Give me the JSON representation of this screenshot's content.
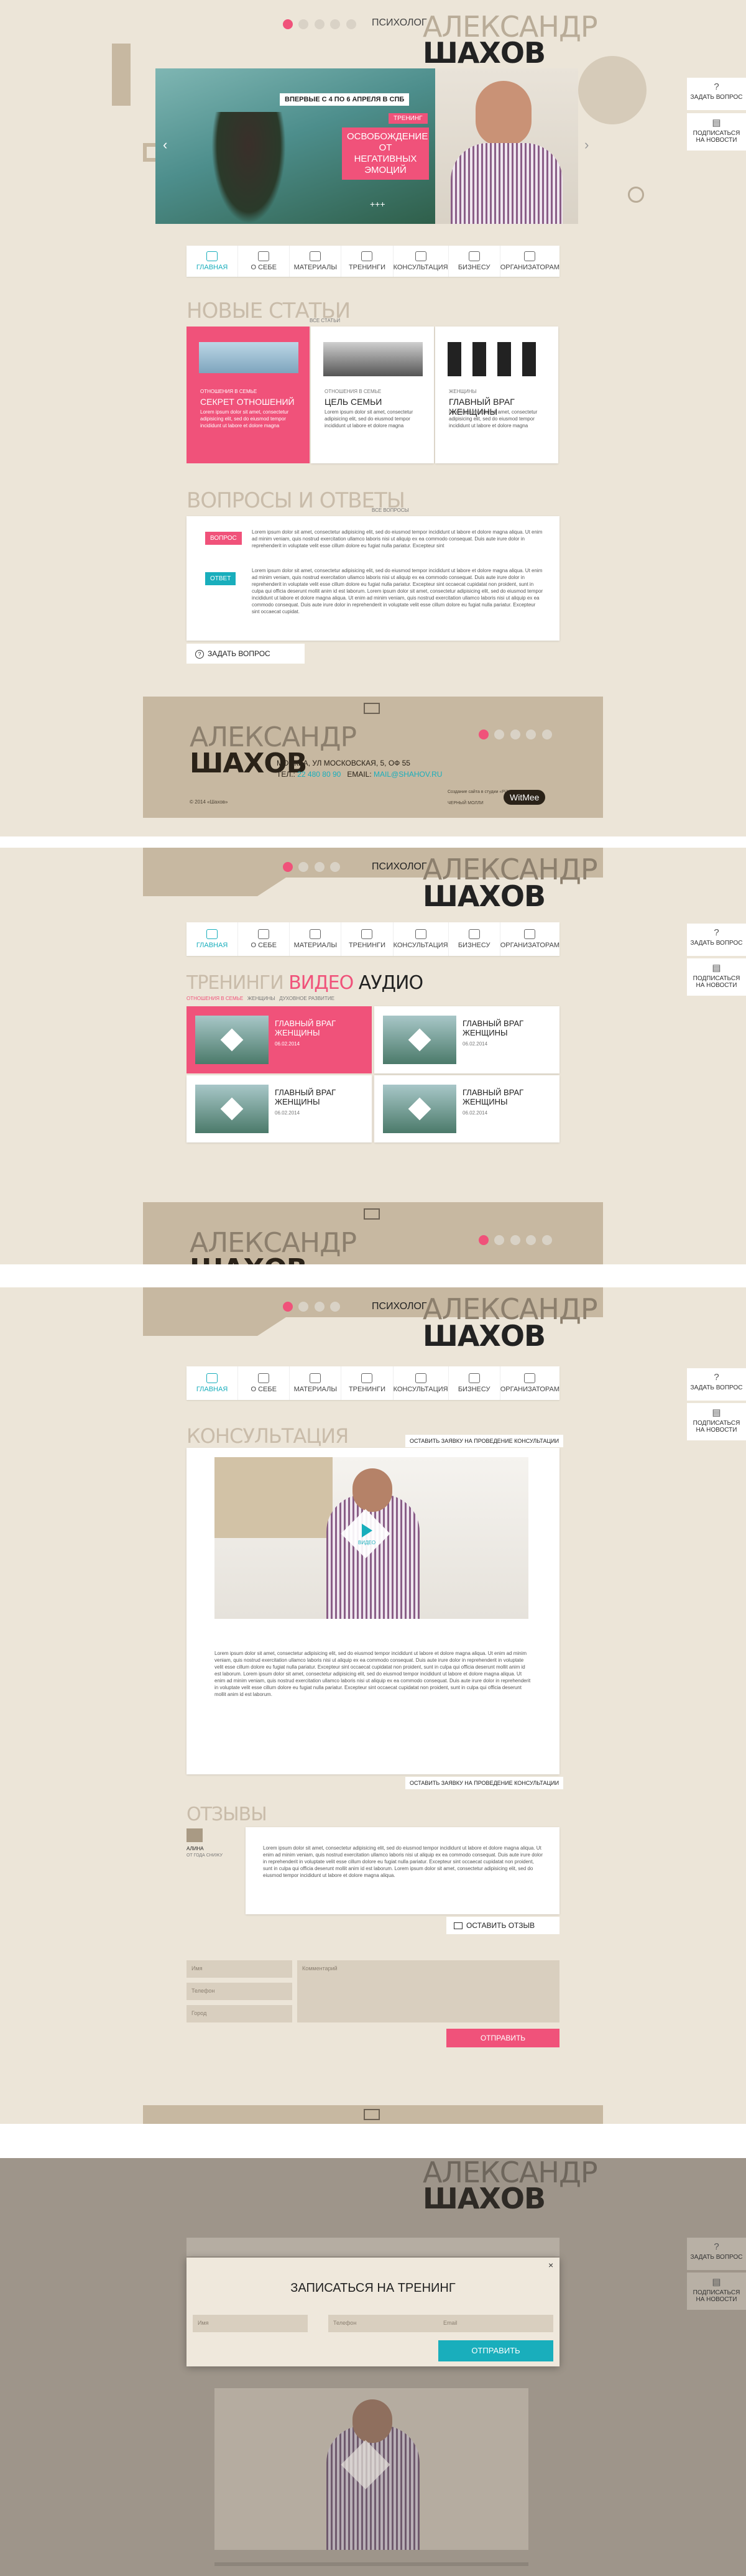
{
  "brand": {
    "first_name": "АЛЕКСАНДР",
    "last_name": "ШАХОВ",
    "role": "ПСИХОЛОГ"
  },
  "nav": [
    {
      "label": "ГЛАВНАЯ"
    },
    {
      "label": "О СЕБЕ"
    },
    {
      "label": "МАТЕРИАЛЫ"
    },
    {
      "label": "ТРЕНИНГИ"
    },
    {
      "label": "КОНСУЛЬТАЦИЯ"
    },
    {
      "label": "БИЗНЕСУ"
    },
    {
      "label": "ОРГАНИЗАТОРАМ"
    }
  ],
  "side": {
    "ask": "ЗАДАТЬ ВОПРОС",
    "subscribe": "ПОДПИСАТЬСЯ НА НОВОСТИ"
  },
  "hero": {
    "date_text": "ВПЕРВЫЕ С 4 ПО 6 АПРЕЛЯ В СПБ",
    "tag": "ТРЕНИНГ",
    "headline": "ОСВОБОЖДЕНИЕ ОТ НЕГАТИВНЫХ ЭМОЦИЙ",
    "more": "+++"
  },
  "articles": {
    "title": "НОВЫЕ СТАТЬИ",
    "all": "ВСЕ СТАТЬИ",
    "items": [
      {
        "category": "ОТНОШЕНИЯ В СЕМЬЕ",
        "title": "СЕКРЕТ ОТНОШЕНИЙ",
        "text": "Lorem ipsum dolor sit amet, consectetur adipisicing elit, sed do eiusmod tempor incididunt ut labore et dolore magna"
      },
      {
        "category": "ОТНОШЕНИЯ В СЕМЬЕ",
        "title": "ЦЕЛЬ СЕМЬИ",
        "text": "Lorem ipsum dolor sit amet, consectetur adipisicing elit, sed do eiusmod tempor incididunt ut labore et dolore magna"
      },
      {
        "category": "ЖЕНЩИНЫ",
        "title": "ГЛАВНЫЙ ВРАГ ЖЕНЩИНЫ",
        "text": "Lorem ipsum dolor sit amet, consectetur adipisicing elit, sed do eiusmod tempor incididunt ut labore et dolore magna"
      }
    ]
  },
  "qa": {
    "title": "ВОПРОСЫ И ОТВЕТЫ",
    "all": "ВСЕ ВОПРОСЫ",
    "q_label": "ВОПРОС",
    "a_label": "ОТВЕТ",
    "q_text": "Lorem ipsum dolor sit amet, consectetur adipisicing elit, sed do eiusmod tempor incididunt ut labore et dolore magna aliqua. Ut enim ad minim veniam, quis nostrud exercitation ullamco laboris nisi ut aliquip ex ea commodo consequat. Duis aute irure dolor in reprehenderit in voluptate velit esse cillum dolore eu fugiat nulla pariatur. Excepteur sint",
    "a_text": "Lorem ipsum dolor sit amet, consectetur adipisicing elit, sed do eiusmod tempor incididunt ut labore et dolore magna aliqua. Ut enim ad minim veniam, quis nostrud exercitation ullamco laboris nisi ut aliquip ex ea commodo consequat. Duis aute irure dolor in reprehenderit in voluptate velit esse cillum dolore eu fugiat nulla pariatur. Excepteur sint occaecat cupidatat non proident, sunt in culpa qui officia deserunt mollit anim id est laborum. Lorem ipsum dolor sit amet, consectetur adipisicing elit, sed do eiusmod tempor incididunt ut labore et dolore magna aliqua. Ut enim ad minim veniam, quis nostrud exercitation ullamco laboris nisi ut aliquip ex ea commodo consequat. Duis aute irure dolor in reprehenderit in voluptate velit esse cillum dolore eu fugiat nulla pariatur. Excepteur sint occaecat cupidat.",
    "ask_btn": "ЗАДАТЬ ВОПРОС"
  },
  "footer": {
    "address": "МОСКВА, УЛ МОСКОВСКАЯ, 5, ОФ 55",
    "tel_label": "ТЕЛ.:",
    "tel": "22 480 80 90",
    "email_label": "EMAIL:",
    "email": "MAIL@SHAHOV.RU",
    "copyright": "© 2014 «Шахов»",
    "made_by": "Создание сайта в студии «Pi3»",
    "studio": "ЧЕРНЫЙ МОЛЛИ",
    "logo": "WitMee"
  },
  "trainings": {
    "t1": "ТРЕНИНГИ",
    "t2": "ВИДЕО",
    "t3": "АУДИО",
    "filters": [
      "ОТНОШЕНИЯ В СЕМЬЕ",
      "ЖЕНЩИНЫ",
      "ДУХОВНОЕ РАЗВИТИЕ"
    ],
    "items": [
      {
        "title": "ГЛАВНЫЙ ВРАГ ЖЕНЩИНЫ",
        "date": "06.02.2014"
      },
      {
        "title": "ГЛАВНЫЙ ВРАГ ЖЕНЩИНЫ",
        "date": "06.02.2014"
      },
      {
        "title": "ГЛАВНЫЙ ВРАГ ЖЕНЩИНЫ",
        "date": "06.02.2014"
      },
      {
        "title": "ГЛАВНЫЙ ВРАГ ЖЕНЩИНЫ",
        "date": "06.02.2014"
      }
    ]
  },
  "consult": {
    "title": "КОНСУЛЬТАЦИЯ",
    "apply": "ОСТАВИТЬ ЗАЯВКУ НА ПРОВЕДЕНИЕ КОНСУЛЬТАЦИИ",
    "play": "ВИДЕО",
    "text": "Lorem ipsum dolor sit amet, consectetur adipisicing elit, sed do eiusmod tempor incididunt ut labore et dolore magna aliqua. Ut enim ad minim veniam, quis nostrud exercitation ullamco laboris nisi ut aliquip ex ea commodo consequat. Duis aute irure dolor in reprehenderit in voluptate velit esse cillum dolore eu fugiat nulla pariatur. Excepteur sint occaecat cupidatat non proident, sunt in culpa qui officia deserunt mollit anim id est laborum. Lorem ipsum dolor sit amet, consectetur adipisicing elit, sed do eiusmod tempor incididunt ut labore et dolore magna aliqua. Ut enim ad minim veniam, quis nostrud exercitation ullamco laboris nisi ut aliquip ex ea commodo consequat. Duis aute irure dolor in reprehenderit in voluptate velit esse cillum dolore eu fugiat nulla pariatur. Excepteur sint occaecat cupidatat non proident, sunt in culpa qui officia deserunt mollit anim id est laborum."
  },
  "reviews": {
    "title": "ОТЗЫВЫ",
    "name": "АЛИНА",
    "city": "ОТ ГОДА СНИЖУ",
    "text": "Lorem ipsum dolor sit amet, consectetur adipisicing elit, sed do eiusmod tempor incididunt ut labore et dolore magna aliqua. Ut enim ad minim veniam, quis nostrud exercitation ullamco laboris nisi ut aliquip ex ea commodo consequat. Duis aute irure dolor in reprehenderit in voluptate velit esse cillum dolore eu fugiat nulla pariatur. Excepteur sint occaecat cupidatat non proident, sunt in culpa qui officia deserunt mollit anim id est laborum. Lorem ipsum dolor sit amet, consectetur adipisicing elit, sed do eiusmod tempor incididunt ut labore et dolore magna aliqua.",
    "leave": "ОСТАВИТЬ ОТЗЫВ",
    "form": {
      "name": "Имя",
      "phone": "Телефон",
      "city": "Город",
      "comment": "Комментарий",
      "submit": "ОТПРАВИТЬ"
    }
  },
  "modal": {
    "title": "ЗАПИСАТЬСЯ НА ТРЕНИНГ",
    "name": "Имя",
    "phone": "Телефон",
    "email": "Email",
    "submit": "ОТПРАВИТЬ",
    "close": "×"
  },
  "colors": {
    "accent_pink": "#f0527a",
    "accent_teal": "#19aebc",
    "bg": "#ece5d8",
    "tan": "#c7b8a1"
  }
}
